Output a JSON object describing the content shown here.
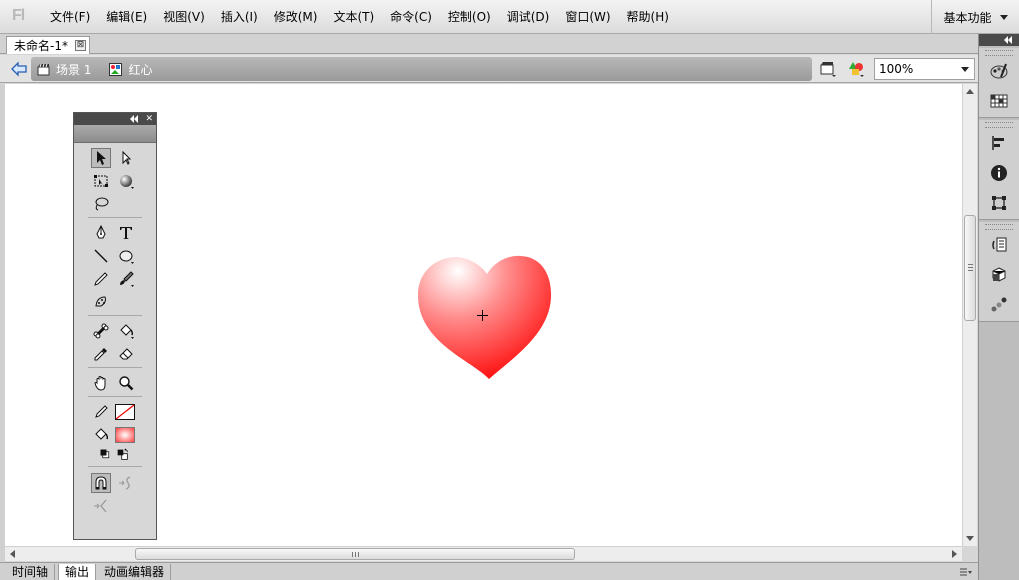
{
  "app": {
    "logo": "Fl"
  },
  "menu": [
    {
      "label": "文件(F)"
    },
    {
      "label": "编辑(E)"
    },
    {
      "label": "视图(V)"
    },
    {
      "label": "插入(I)"
    },
    {
      "label": "修改(M)"
    },
    {
      "label": "文本(T)"
    },
    {
      "label": "命令(C)"
    },
    {
      "label": "控制(O)"
    },
    {
      "label": "调试(D)"
    },
    {
      "label": "窗口(W)"
    },
    {
      "label": "帮助(H)"
    }
  ],
  "workspace": {
    "label": "基本功能"
  },
  "document": {
    "tab_label": "未命名-1*",
    "close_glyph": "⊠"
  },
  "breadcrumb": [
    {
      "label": "场景 1",
      "icon": "scene-clapper-icon"
    },
    {
      "label": "红心",
      "icon": "graphic-symbol-icon"
    }
  ],
  "zoom": {
    "value": "100%"
  },
  "bottom_tabs": [
    {
      "label": "时间轴"
    },
    {
      "label": "输出"
    },
    {
      "label": "动画编辑器"
    }
  ],
  "colors": {
    "heart_highlight": "#ffffff",
    "heart_mid": "#ff8a8a",
    "heart_edge": "#ff0000",
    "fill_swatch": "#ff5050"
  },
  "tools_panel": {
    "close_glyph": "✕"
  },
  "tools": [
    "selection-tool-icon",
    "subselection-tool-icon",
    "free-transform-tool-icon",
    "3d-rotation-tool-icon",
    "lasso-tool-icon",
    "pen-tool-icon",
    "text-tool-icon",
    "line-tool-icon",
    "oval-tool-icon",
    "pencil-tool-icon",
    "brush-tool-icon",
    "deco-tool-icon",
    "bone-tool-icon",
    "paint-bucket-tool-icon",
    "eyedropper-tool-icon",
    "eraser-tool-icon",
    "hand-tool-icon",
    "zoom-tool-icon",
    "stroke-color-icon",
    "fill-color-icon",
    "black-white-icon",
    "swap-colors-icon",
    "snap-to-objects-icon",
    "smooth-icon",
    "straighten-icon"
  ],
  "dock": [
    "color-palette-icon",
    "swatches-icon",
    "align-icon",
    "info-icon",
    "transform-icon",
    "actions-icon",
    "components-icon",
    "motion-presets-icon"
  ]
}
